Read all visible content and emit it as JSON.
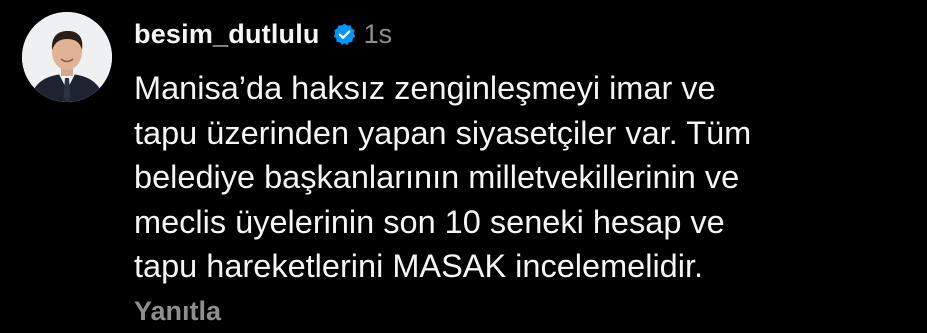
{
  "comment": {
    "username": "besim_dutlulu",
    "verified_icon": "verified-badge-icon",
    "time": "1s",
    "text_lines": [
      "Manisa’da haksız zenginleşmeyi imar ve",
      "tapu üzerinden yapan siyasetçiler var. Tüm",
      "belediye başkanlarının milletvekillerinin ve",
      "meclis üyelerinin son 10 seneki hesap ve",
      "tapu hareketlerini MASAK incelemelidir."
    ],
    "reply_label": "Yanıtla"
  },
  "colors": {
    "background": "#000000",
    "text": "#f5f5f5",
    "muted": "#8e8e8e",
    "verified": "#0095f6"
  }
}
